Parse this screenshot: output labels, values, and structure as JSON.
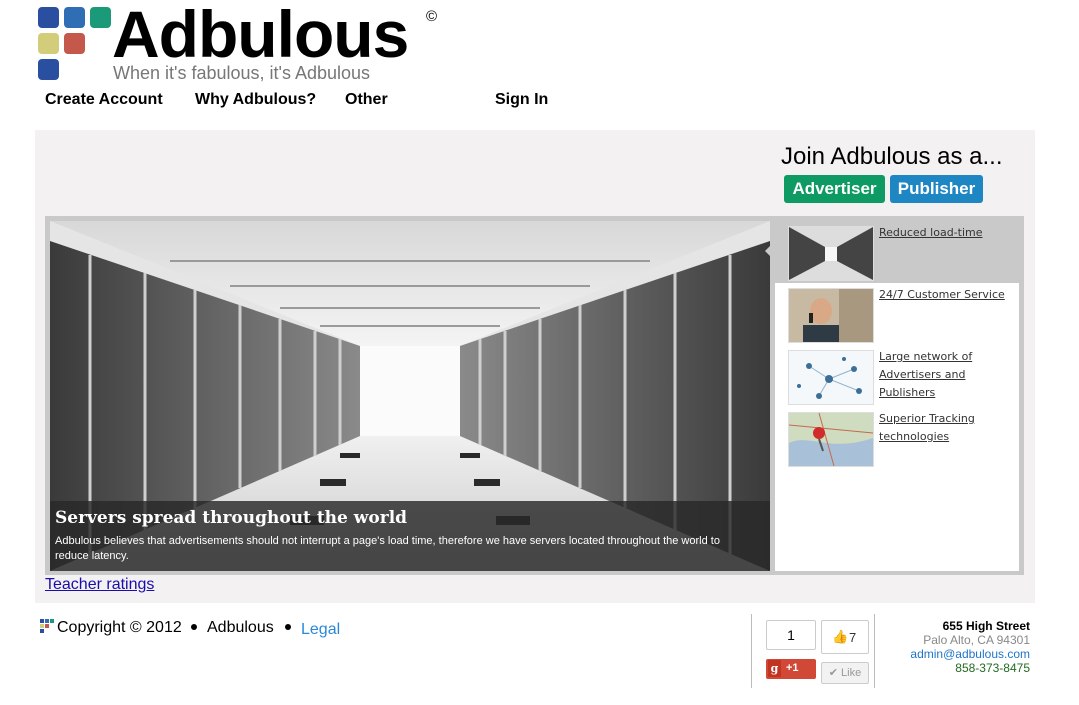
{
  "brand": {
    "name": "Adbulous",
    "copyright_mark": "©",
    "tagline": "When it's fabulous, it's Adbulous",
    "logo_colors": [
      "#2b4fa0",
      "#2f6db5",
      "#1a9a78",
      "#d3cd7b",
      "#c4584a",
      "#2b4fa0"
    ]
  },
  "nav": {
    "create_account": "Create Account",
    "why": "Why Adbulous?",
    "other": "Other",
    "sign_in": "Sign In"
  },
  "join": {
    "title": "Join Adbulous as a...",
    "advertiser": "Advertiser",
    "publisher": "Publisher",
    "advertiser_color": "#0e9a63",
    "publisher_color": "#1f86c4"
  },
  "slider": {
    "caption_title": "Servers spread throughout the world",
    "caption_text": "Adbulous believes that advertisements should not interrupt a page's load time, therefore we have servers located throughout the world to reduce latency.",
    "items": [
      {
        "label": "Reduced load-time",
        "active": true
      },
      {
        "label": "24/7 Customer Service",
        "active": false
      },
      {
        "label": "Large network of Advertisers and Publishers",
        "active": false
      },
      {
        "label": "Superior Tracking technologies",
        "active": false
      }
    ]
  },
  "teacher_link": "Teacher ratings",
  "footer": {
    "copyright": "Copyright © 2012",
    "company": "Adbulous",
    "legal": "Legal",
    "gplus_count": "1",
    "gplus_label": "+1",
    "like_count": "7",
    "like_label": "Like",
    "address": {
      "street": "655 High Street",
      "city": "Palo Alto, CA 94301",
      "email": "admin@adbulous.com",
      "phone": "858-373-8475"
    }
  }
}
